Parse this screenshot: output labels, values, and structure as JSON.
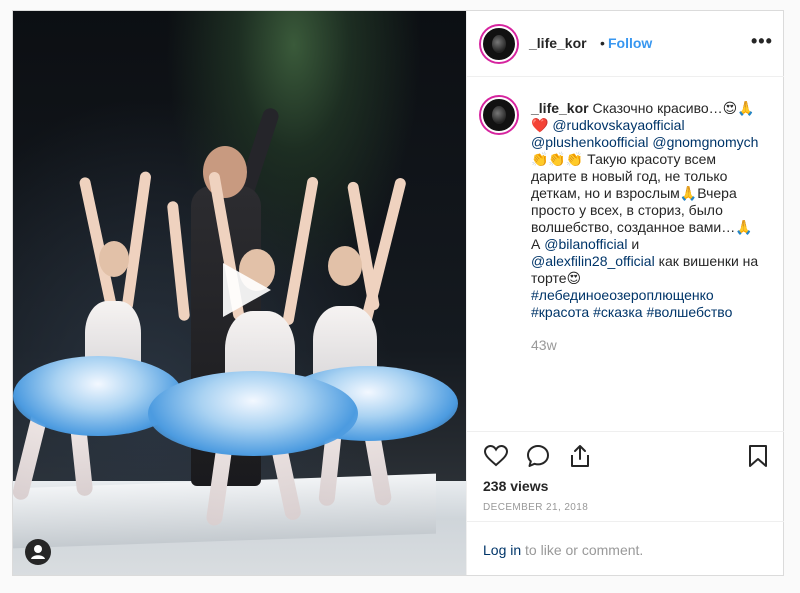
{
  "post": {
    "username": "_life_kor",
    "separator": "•",
    "follow_label": "Follow",
    "more_label": "•••",
    "caption": {
      "line1_text": "Сказочно красиво…😍🙏",
      "line2_prefix": "❤️ ",
      "line2_mention": "@rudkovskayaofficial",
      "line3_mention1": "@plushenkoofficial",
      "line3_mention2": "@gnomgnomych",
      "line4": "👏👏👏 Такую красоту всем",
      "line5": "дарите в новый год, не только",
      "line6": "деткам, но и взрослым🙏Вчера",
      "line7": "просто у всех, в сториз, было",
      "line8": "волшебство, созданное вами…🙏",
      "line9_prefix": "А ",
      "line9_mention": "@bilanofficial",
      "line9_suffix": " и",
      "line10_mention": "@alexfilin28_official",
      "line10_suffix": " как вишенки на",
      "line11": "торте😍",
      "hashtags_line1": "#лебединоеозероплющенко",
      "hashtag_a": "#красота",
      "hashtag_b": "#сказка",
      "hashtag_c": "#волшебство"
    },
    "time_ago": "43w",
    "icons": [
      "heart-icon",
      "comment-icon",
      "share-icon",
      "bookmark-icon",
      "play-icon",
      "user-tag-icon"
    ],
    "views": "238 views",
    "date": "DECEMBER 21, 2018",
    "login_link": "Log in",
    "login_suffix": " to like or comment.",
    "colors": {
      "follow": "#3897f0",
      "link": "#003569",
      "muted": "#999999",
      "text": "#262626",
      "story_ring": "#d6249f"
    }
  }
}
